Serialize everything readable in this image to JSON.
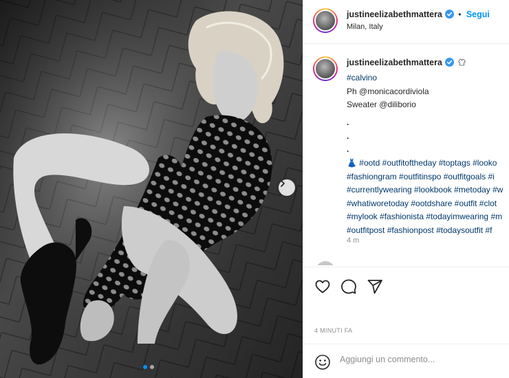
{
  "post": {
    "username": "justineelizabethmattera",
    "follow_label": "Segui",
    "separator": "•",
    "location": "Milan, Italy",
    "caption_lines": [
      "#calvino",
      "Ph @monicacordiviola",
      "Sweater @diliborio",
      ".",
      ".",
      ".",
      "👗 #ootd #outfitoftheday #toptags #looko",
      "#fashiongram #outfitinspo #outfitgoals #i",
      "#currentlywearing #lookbook #metoday #w",
      "#whatiworetoday #ootdshare #outfit #clot",
      "#mylook #fashionista #todayimwearing #m",
      "#outfitpost #fashionpost #todaysoutfit #f"
    ],
    "caption_age": "4 m",
    "posted_time": "4 MINUTI FA",
    "comment_placeholder": "Aggiungi un commento..."
  },
  "carousel": {
    "slide_count": 2,
    "active_index": 0
  },
  "icons": {
    "verified": "verified-badge-icon",
    "heart": "heart-icon",
    "comment": "comment-icon",
    "share": "paper-plane-icon",
    "emoji": "smiley-icon",
    "next": "chevron-right-icon"
  },
  "colors": {
    "link": "#00376b",
    "accent": "#0095f6",
    "muted": "#8e8e8e",
    "text": "#262626",
    "border": "#efefef"
  }
}
